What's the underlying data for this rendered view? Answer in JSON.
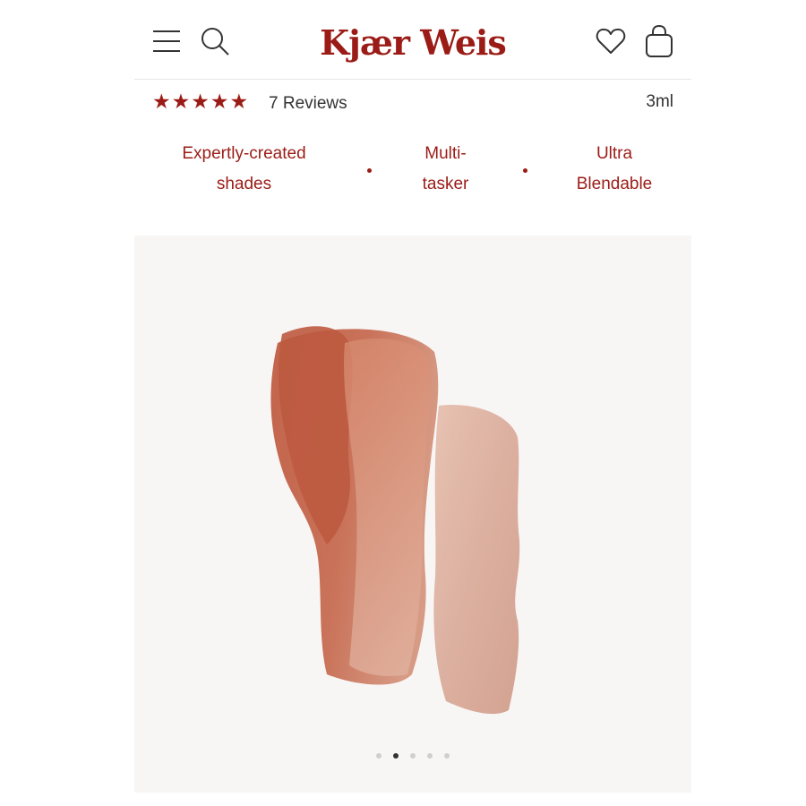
{
  "header": {
    "brand": "Kjær Weis",
    "brand_color": "#9b1c17",
    "icons": [
      "menu-icon",
      "search-icon",
      "heart-icon",
      "bag-icon"
    ]
  },
  "product": {
    "rating": 5,
    "rating_max": 5,
    "reviews": "7 Reviews",
    "size": "3ml"
  },
  "features": [
    {
      "label": "Expertly-created\nshades"
    },
    {
      "label": "Multi-\ntasker"
    },
    {
      "label": "Ultra\nBlendable"
    }
  ],
  "gallery": {
    "image": "swatch-image",
    "swatch_colors": [
      "#c2644b",
      "#dcb0a0"
    ],
    "slide_count": 5,
    "active_slide": 2
  }
}
